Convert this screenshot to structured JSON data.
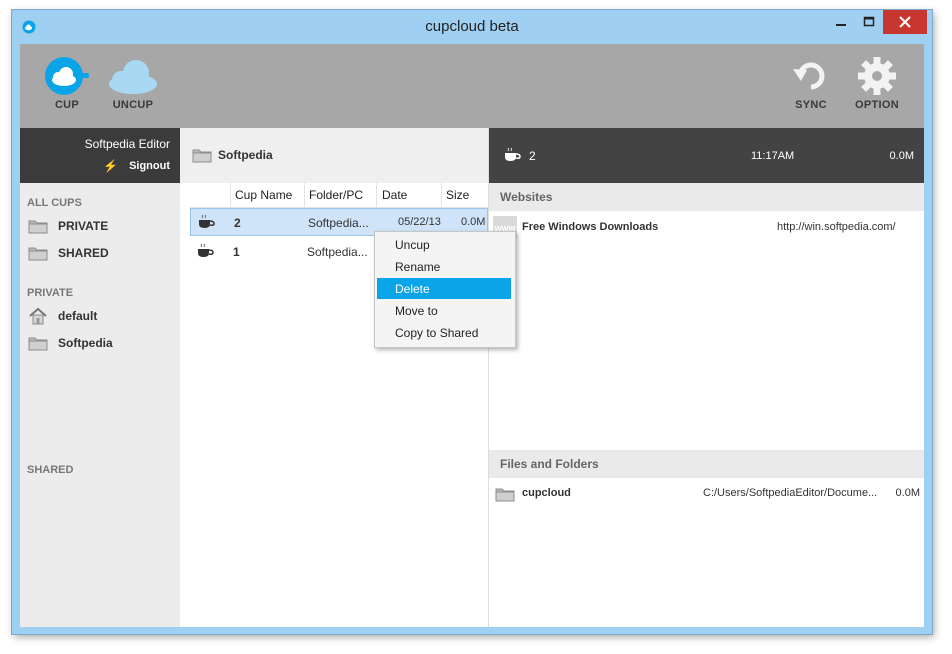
{
  "window": {
    "title": "cupcloud beta"
  },
  "toolbar": {
    "cup_label": "CUP",
    "uncup_label": "UNCUP",
    "sync_label": "SYNC",
    "option_label": "OPTION"
  },
  "user": {
    "name": "Softpedia Editor",
    "signout_label": "Signout"
  },
  "sidebar": {
    "all_cups_heading": "ALL CUPS",
    "all_cups_items": [
      "PRIVATE",
      "SHARED"
    ],
    "private_heading": "PRIVATE",
    "private_items": [
      "default",
      "Softpedia"
    ],
    "shared_heading": "SHARED"
  },
  "middle": {
    "breadcrumb": "Softpedia",
    "columns": [
      "Cup Name",
      "Folder/PC",
      "Date",
      "Size"
    ],
    "rows": [
      {
        "name": "2",
        "folder": "Softpedia...",
        "date": "05/22/13",
        "size": "0.0M"
      },
      {
        "name": "1",
        "folder": "Softpedia...",
        "date": "",
        "size": ""
      }
    ]
  },
  "detail": {
    "cup_name": "2",
    "time": "11:17AM",
    "size": "0.0M",
    "websites_heading": "Websites",
    "websites": [
      {
        "title": "Free Windows Downloads",
        "url": "http://win.softpedia.com/"
      }
    ],
    "files_heading": "Files and Folders",
    "files": [
      {
        "name": "cupcloud",
        "path": "C:/Users/SoftpediaEditor/Docume...",
        "size": "0.0M"
      }
    ]
  },
  "context_menu": {
    "items": [
      "Uncup",
      "Rename",
      "Delete",
      "Move to",
      "Copy to Shared"
    ],
    "highlighted": "Delete"
  },
  "colors": {
    "accent": "#0aa4e8",
    "selection": "#cfe4f8",
    "dark_bar": "#434343"
  }
}
